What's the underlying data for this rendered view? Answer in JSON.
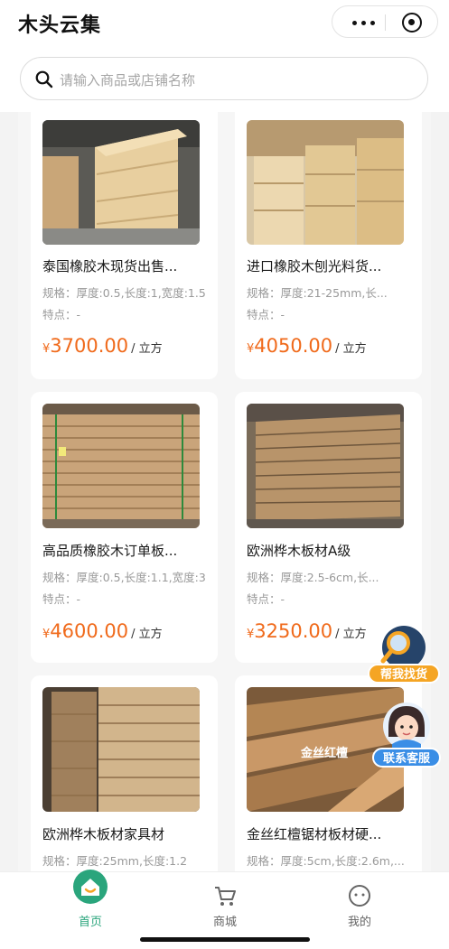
{
  "header": {
    "app_title": "木头云集",
    "search_placeholder": "请输入商品或店铺名称"
  },
  "colors": {
    "accent": "#f06a1b",
    "primary": "#2aa57c",
    "badge": "#f5a524",
    "service": "#3a8ee6"
  },
  "products": [
    {
      "name": "泰国橡胶木现货出售...",
      "spec": "规格：厚度:0.5,长度:1,宽度:1.5",
      "feature": "特点：-",
      "yen": "¥",
      "price": "3700.00",
      "unit": "/ 立方"
    },
    {
      "name": "进口橡胶木刨光料货...",
      "spec": "规格：厚度:21-25mm,长...",
      "feature": "特点：-",
      "yen": "¥",
      "price": "4050.00",
      "unit": "/ 立方"
    },
    {
      "name": "高品质橡胶木订单板...",
      "spec": "规格：厚度:0.5,长度:1.1,宽度:3",
      "feature": "特点：-",
      "yen": "¥",
      "price": "4600.00",
      "unit": "/ 立方"
    },
    {
      "name": "欧洲桦木板材A级",
      "spec": "规格：厚度:2.5-6cm,长...",
      "feature": "特点：-",
      "yen": "¥",
      "price": "3250.00",
      "unit": "/ 立方"
    },
    {
      "name": "欧洲桦木板材家具材",
      "spec": "规格：厚度:25mm,长度:1.2",
      "feature": "",
      "yen": "",
      "price": "",
      "unit": ""
    },
    {
      "name": "金丝红檀锯材板材硬...",
      "spec": "规格：厚度:5cm,长度:2.6m,...",
      "feature": "",
      "yen": "",
      "price": "",
      "unit": "",
      "image_text": "金丝红檀"
    }
  ],
  "floating": {
    "find_goods": "帮我找货",
    "customer_service": "联系客服"
  },
  "tabbar": {
    "home": "首页",
    "mall": "商城",
    "mine": "我的",
    "active": "首页"
  }
}
